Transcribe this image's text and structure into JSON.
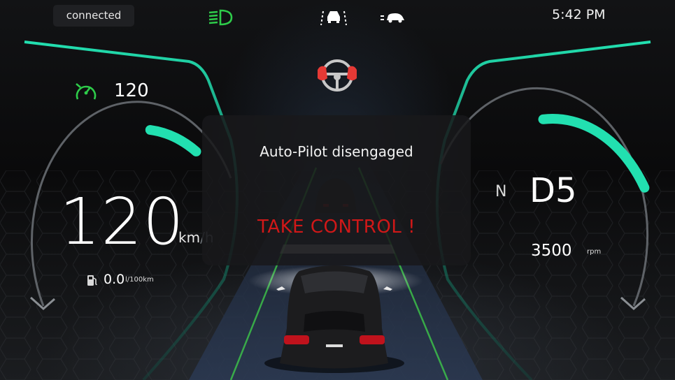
{
  "status": {
    "connection": "connected"
  },
  "clock": {
    "time": "5:42 PM"
  },
  "top_icons": [
    "low-beam-headlight-icon",
    "lane-assist-icon",
    "adaptive-cruise-icon"
  ],
  "center_icon": "hands-on-wheel-icon",
  "speed_limit": {
    "value": "120",
    "icon": "speed-limiter-icon"
  },
  "speedometer": {
    "value": "120",
    "unit_main": "km",
    "unit_sub": "/h",
    "level": 0.12
  },
  "fuel": {
    "value": "0.0",
    "unit": "l/100km",
    "icon": "fuel-pump-icon"
  },
  "gear": {
    "neutral": "N",
    "drive": "D5"
  },
  "tachometer": {
    "value": "3500",
    "unit": "rpm",
    "level": 0.45
  },
  "popup": {
    "message": "Auto-Pilot disengaged",
    "alert": "TAKE CONTROL !"
  },
  "colors": {
    "accent": "#22e0b0",
    "alert": "#d01818",
    "indicator": "#2ecc4a",
    "warning_icon": "#e53935"
  }
}
